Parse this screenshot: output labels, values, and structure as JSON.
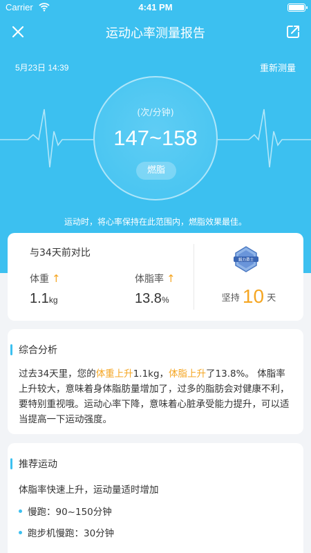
{
  "status_bar": {
    "carrier": "Carrier",
    "time": "4:41 PM"
  },
  "nav": {
    "title": "运动心率测量报告"
  },
  "header": {
    "date": "5月23日 14:39",
    "remeasure_label": "重新测量",
    "unit": "(次/分钟)",
    "range": "147~158",
    "zone": "燃脂",
    "tip": "运动时，将心率保持在此范围内，燃脂效果最佳。"
  },
  "compare": {
    "heading": "与34天前对比",
    "weight": {
      "label": "体重",
      "arrow": "↑",
      "value": "1.1",
      "unit": "kg"
    },
    "body_fat": {
      "label": "体脂率",
      "arrow": "↑",
      "value": "13.8",
      "unit": "%"
    },
    "medal_text": "毅力勇士",
    "persist_prefix": "坚持",
    "persist_days": "10",
    "persist_suffix": "天"
  },
  "analysis": {
    "title": "综合分析",
    "p1": "过去34天里，您的",
    "hl1": "体重上升",
    "p2": "1.1kg，",
    "hl2": "体脂上升",
    "p3": "了13.8%。 体脂率上升较大，意味着身体脂肪量增加了，过多的脂肪会对健康不利，要特别重视哦。运动心率下降，意味着心脏承受能力提升，可以适当提高一下运动强度。"
  },
  "recommend": {
    "title": "推荐运动",
    "intro": "体脂率快速上升，运动量适时增加",
    "items": [
      "慢跑：90~150分钟",
      "跑步机慢跑：30分钟"
    ]
  },
  "colors": {
    "primary": "#3cc0f0",
    "accent": "#f5a623",
    "background": "#f2f4f7"
  },
  "icons": {
    "close": "close-icon",
    "share": "share-icon",
    "medal": "medal-icon",
    "wifi": "wifi-icon",
    "battery": "battery-icon"
  }
}
